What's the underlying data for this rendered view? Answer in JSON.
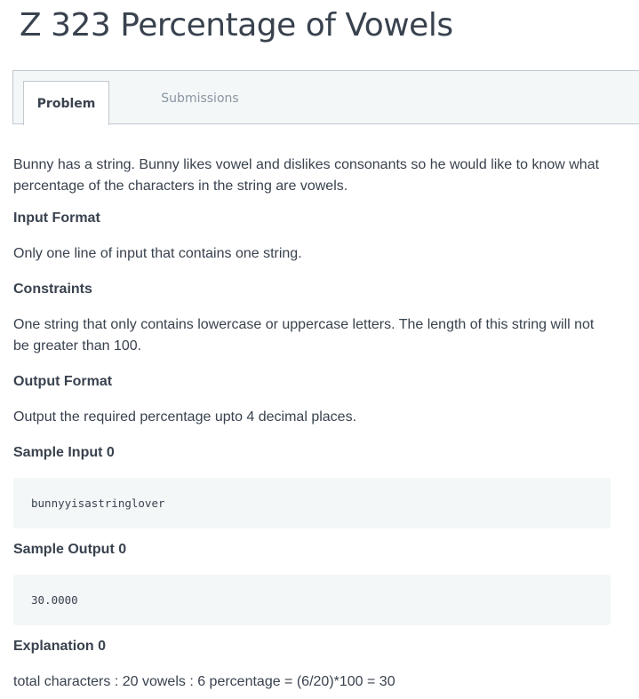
{
  "header": {
    "title": "Z 323 Percentage of Vowels"
  },
  "tabs": [
    {
      "label": "Problem",
      "active": true
    },
    {
      "label": "Submissions",
      "active": false
    }
  ],
  "problem": {
    "statement": "Bunny has a string. Bunny likes vowel and dislikes consonants so he would like to know what percentage of the characters in the string are vowels.",
    "input_format_heading": "Input Format",
    "input_format_text": "Only one line of input that contains one string.",
    "constraints_heading": "Constraints",
    "constraints_text": "One string that only contains lowercase or uppercase letters. The length of this string will not be greater than 100.",
    "output_format_heading": "Output Format",
    "output_format_text": "Output the required percentage upto 4 decimal places.",
    "sample_input_heading": "Sample Input 0",
    "sample_input": "bunnyyisastringlover",
    "sample_output_heading": "Sample Output 0",
    "sample_output": "30.0000",
    "explanation_heading": "Explanation 0",
    "explanation_text": "total characters : 20 vowels : 6 percentage = (6/20)*100 = 30"
  },
  "colors": {
    "text": "#39424e",
    "muted_tab": "#8a95a3",
    "panel_bg": "#f3f7f7",
    "border": "#c2c7d0"
  }
}
